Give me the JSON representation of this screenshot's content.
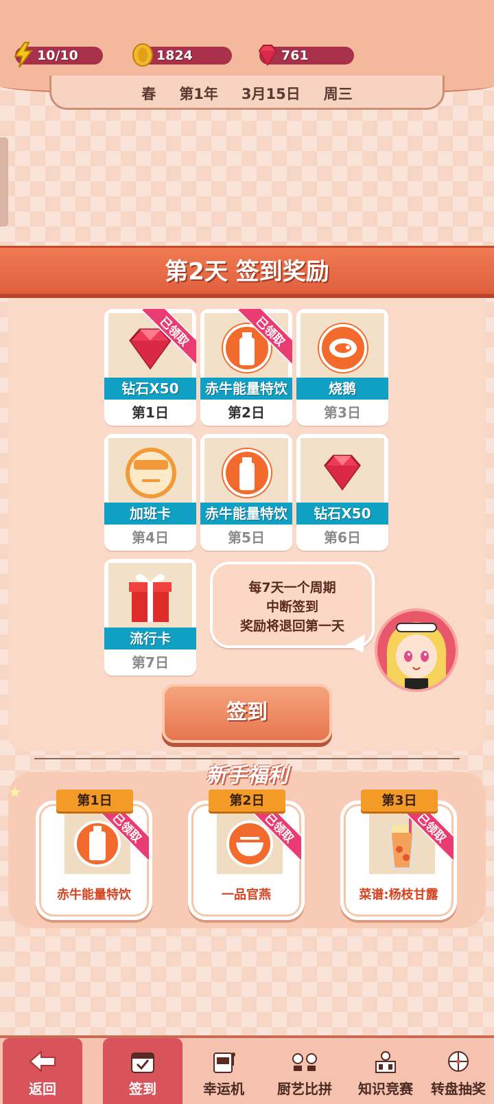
{
  "resources": {
    "energy": "10/10",
    "coins": "1824",
    "gems": "761"
  },
  "date": {
    "season": "春",
    "year": "第1年",
    "day": "3月15日",
    "weekday": "周三"
  },
  "signin": {
    "banner_title": "第2天 签到奖励",
    "claimed_label": "已领取",
    "rewards": [
      {
        "name": "钻石X50",
        "day": "第1日",
        "icon": "gem-icon",
        "claimed": true
      },
      {
        "name": "赤牛能量特饮",
        "day": "第2日",
        "icon": "bottle-icon",
        "claimed": true
      },
      {
        "name": "烧鹅",
        "day": "第3日",
        "icon": "meat-icon",
        "claimed": false
      },
      {
        "name": "加班卡",
        "day": "第4日",
        "icon": "card-face-icon",
        "claimed": false
      },
      {
        "name": "赤牛能量特饮",
        "day": "第5日",
        "icon": "bottle-icon",
        "claimed": false
      },
      {
        "name": "钻石X50",
        "day": "第6日",
        "icon": "gem-icon",
        "claimed": false
      },
      {
        "name": "流行卡",
        "day": "第7日",
        "icon": "gift-icon",
        "claimed": false
      }
    ],
    "tip_line1": "每7天一个周期",
    "tip_line2": "中断签到",
    "tip_line3": "奖励将退回第一天",
    "button_label": "签到"
  },
  "newbie": {
    "title": "新手福利",
    "items": [
      {
        "day": "第1日",
        "name": "赤牛能量特饮",
        "icon": "bottle-icon",
        "claimed": true
      },
      {
        "day": "第2日",
        "name": "一品官燕",
        "icon": "bowl-icon",
        "claimed": true
      },
      {
        "day": "第3日",
        "name": "菜谱:杨枝甘露",
        "icon": "drink-glass-icon",
        "claimed": true
      }
    ]
  },
  "nav": [
    {
      "label": "返回",
      "icon": "back-arrow-icon",
      "active": true
    },
    {
      "label": "签到",
      "icon": "calendar-check-icon",
      "active": true
    },
    {
      "label": "幸运机",
      "icon": "slot-machine-icon",
      "active": false
    },
    {
      "label": "厨艺比拼",
      "icon": "chef-vs-icon",
      "active": false
    },
    {
      "label": "知识竞赛",
      "icon": "quiz-icon",
      "active": false
    },
    {
      "label": "转盘抽奖",
      "icon": "wheel-icon",
      "active": false
    }
  ],
  "colors": {
    "banner": "#e86a45",
    "item_name_bar": "#0fa0c4",
    "claimed_ribbon": "#e83c72",
    "resource_pill": "#a9304a"
  }
}
